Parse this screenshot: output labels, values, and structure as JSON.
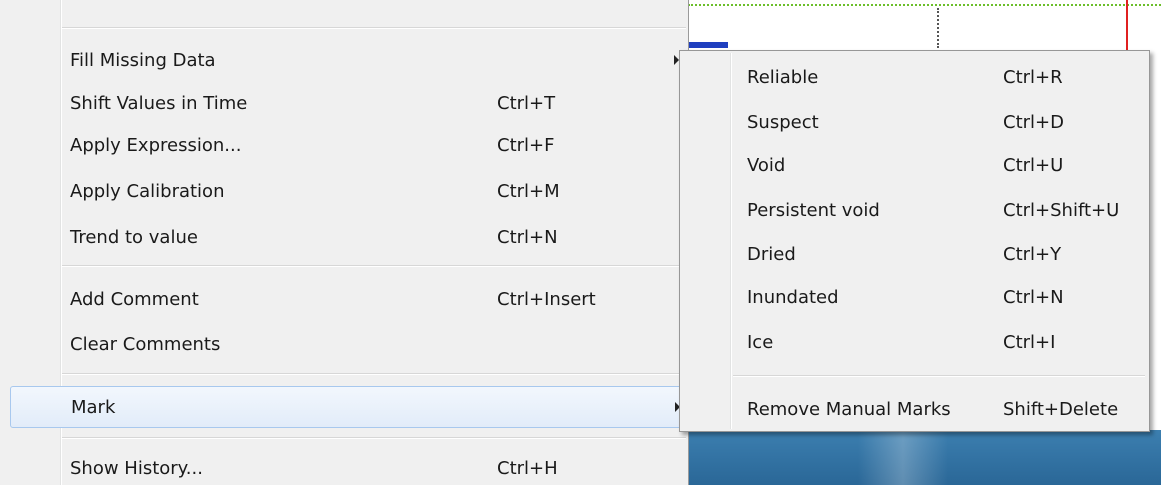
{
  "menu": {
    "items": [
      {
        "label": "Fill Missing Data",
        "shortcut": "",
        "has_submenu": true
      },
      {
        "label": "Shift Values in Time",
        "shortcut": "Ctrl+T"
      },
      {
        "label": "Apply Expression...",
        "shortcut": "Ctrl+F"
      },
      {
        "label": "Apply Calibration",
        "shortcut": "Ctrl+M"
      },
      {
        "label": "Trend to value",
        "shortcut": "Ctrl+N"
      },
      {
        "label": "Add Comment",
        "shortcut": "Ctrl+Insert"
      },
      {
        "label": "Clear Comments",
        "shortcut": ""
      },
      {
        "label": "Mark",
        "shortcut": "",
        "has_submenu": true,
        "highlighted": true
      },
      {
        "label": "Show History...",
        "shortcut": "Ctrl+H"
      }
    ]
  },
  "submenu": {
    "items": [
      {
        "label": "Reliable",
        "shortcut": "Ctrl+R"
      },
      {
        "label": "Suspect",
        "shortcut": "Ctrl+D"
      },
      {
        "label": "Void",
        "shortcut": "Ctrl+U"
      },
      {
        "label": "Persistent void",
        "shortcut": "Ctrl+Shift+U"
      },
      {
        "label": "Dried",
        "shortcut": "Ctrl+Y"
      },
      {
        "label": "Inundated",
        "shortcut": "Ctrl+N"
      },
      {
        "label": "Ice",
        "shortcut": "Ctrl+I"
      },
      {
        "label": "Remove Manual Marks",
        "shortcut": "Shift+Delete"
      }
    ]
  },
  "colors": {
    "menu_bg": "#f0f0f0",
    "highlight_border": "#a8c8ee",
    "grid_dotted": "#6cbf2a",
    "marker_red": "#e02020",
    "series_blue": "#1f3fbf"
  }
}
